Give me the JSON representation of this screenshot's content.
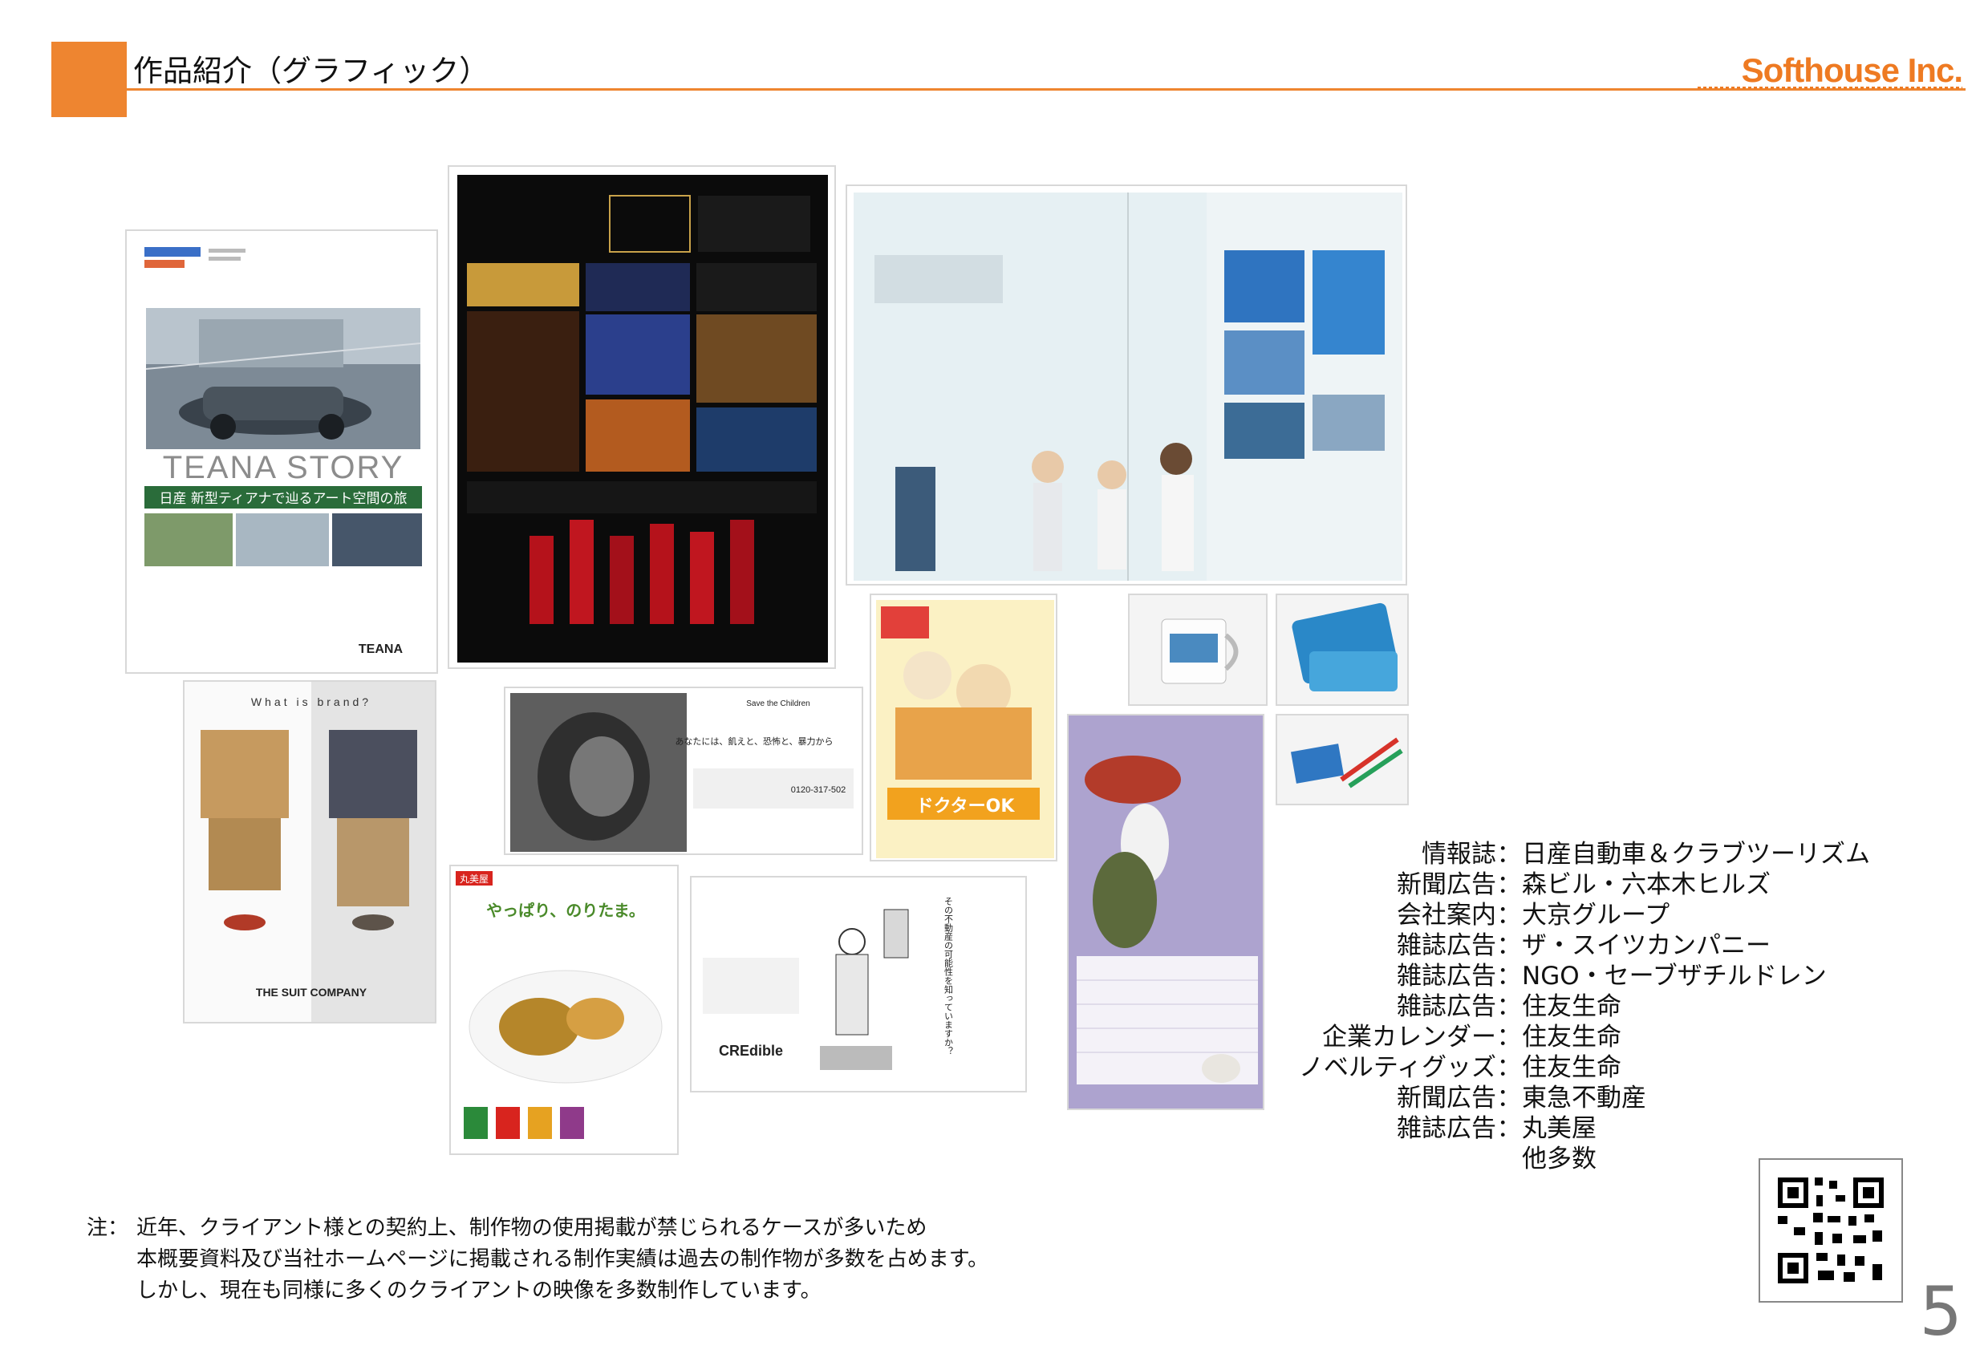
{
  "header": {
    "title": "作品紹介（グラフィック）",
    "brand": "Softhouse Inc.",
    "accent_color": "#ee8530"
  },
  "samples": {
    "teana": {
      "headline": "TEANA STORY",
      "subline": "日産 新型ティアナで辿るアート空間の旅",
      "brand": "TEANA"
    },
    "suit": {
      "headline": "What is brand?",
      "brand": "THE SUIT COMPANY"
    },
    "ngo": {
      "logo": "Save the Children",
      "copy": "あなたには、飢えと、恐怖と、暴力から",
      "phone": "0120-317-502"
    },
    "credible": {
      "brand": "CREdible",
      "copy": "その不動産の可能性を知っていますか？"
    },
    "marumiya": {
      "badge": "丸美屋",
      "headline": "やっぱり、のりたま。"
    },
    "sumitomo": {
      "headline": "ドクターOK"
    }
  },
  "clients": [
    {
      "category": "情報誌",
      "name": "日産自動車＆クラブツーリズム"
    },
    {
      "category": "新聞広告",
      "name": "森ビル・六本木ヒルズ"
    },
    {
      "category": "会社案内",
      "name": "大京グループ"
    },
    {
      "category": "雑誌広告",
      "name": "ザ・スイツカンパニー"
    },
    {
      "category": "雑誌広告",
      "name": "NGO・セーブザチルドレン"
    },
    {
      "category": "雑誌広告",
      "name": "住友生命"
    },
    {
      "category": "企業カレンダー",
      "name": "住友生命"
    },
    {
      "category": "ノベルティグッズ",
      "name": "住友生命"
    },
    {
      "category": "新聞広告",
      "name": "東急不動産"
    },
    {
      "category": "雑誌広告",
      "name": "丸美屋"
    },
    {
      "category": "",
      "name": "他多数"
    }
  ],
  "client_separator": "：",
  "notes": {
    "prefix": "注：",
    "lines": [
      "近年、クライアント様との契約上、制作物の使用掲載が禁じられるケースが多いため",
      "本概要資料及び当社ホームページに掲載される制作実績は過去の制作物が多数を占めます。",
      "しかし、現在も同様に多くのクライアントの映像を多数制作しています。"
    ]
  },
  "page_number": "5"
}
